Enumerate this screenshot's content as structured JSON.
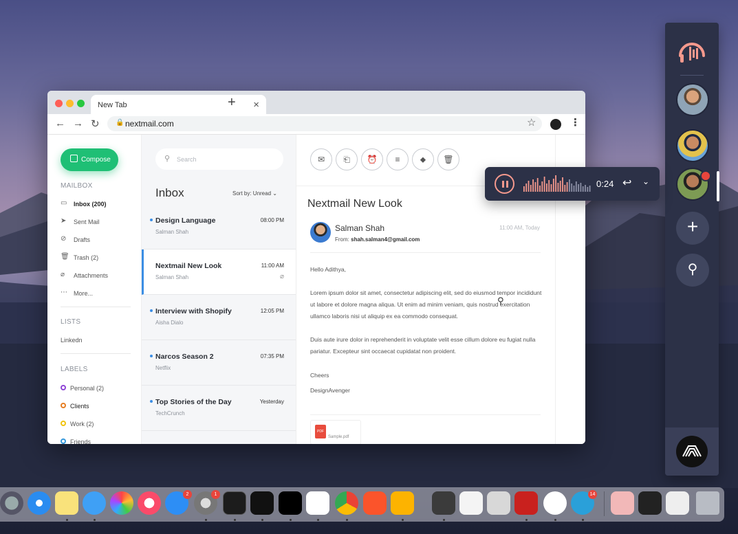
{
  "browser": {
    "tab_title": "New Tab",
    "url": "nextmail.com"
  },
  "sidebar": {
    "compose_label": "Compose",
    "mailbox_title": "MAILBOX",
    "mailbox_items": [
      {
        "label": "Inbox (200)",
        "icon": "inbox-icon"
      },
      {
        "label": "Sent Mail",
        "icon": "send-icon"
      },
      {
        "label": "Drafts",
        "icon": "draft-icon"
      },
      {
        "label": "Trash (2)",
        "icon": "trash-icon"
      },
      {
        "label": "Attachments",
        "icon": "paperclip-icon"
      },
      {
        "label": "More...",
        "icon": "more-icon"
      }
    ],
    "lists_title": "LISTS",
    "lists_items": [
      {
        "label": "Linkedn"
      }
    ],
    "labels_title": "LABELS",
    "labels_items": [
      {
        "label": "Personal (2)",
        "color": "#8e44d6"
      },
      {
        "label": "Clients",
        "color": "#e67e22"
      },
      {
        "label": "Work (2)",
        "color": "#f1c40f"
      },
      {
        "label": "Friends",
        "color": "#3498db"
      }
    ]
  },
  "list": {
    "search_placeholder": "Search",
    "title": "Inbox",
    "sort_label": "Sort by: Unread",
    "messages": [
      {
        "subject": "Design Language",
        "time": "08:00 PM",
        "from": "Salman Shah",
        "unread": true
      },
      {
        "subject": "Nextmail New Look",
        "time": "11:00 AM",
        "from": "Salman Shah",
        "unread": false,
        "attachment": true
      },
      {
        "subject": "Interview with Shopify",
        "time": "12:05 PM",
        "from": "Aisha Dialo",
        "unread": true
      },
      {
        "subject": "Narcos Season 2",
        "time": "07:35 PM",
        "from": "Netflix",
        "unread": true
      },
      {
        "subject": "Top Stories of the Day",
        "time": "Yesterday",
        "from": "TechCrunch",
        "unread": true
      }
    ]
  },
  "reader": {
    "toolbar_icons": [
      "mark-read-icon",
      "move-icon",
      "snooze-icon",
      "notes-icon",
      "tag-icon",
      "delete-icon"
    ],
    "title": "Nextmail New Look",
    "sender": "Salman Shah",
    "from_label": "From:",
    "from_email": "shah.salman4@gmail.com",
    "time": "11:00 AM, Today",
    "greeting": "Hello Adithya,",
    "para1": "Lorem ipsum dolor sit amet, consectetur adipiscing elit, sed do eiusmod tempor incididunt ut labore et dolore magna aliqua. Ut enim ad minim veniam, quis nostrud exercitation ullamco laboris nisi ut aliquip ex ea commodo consequat.",
    "para2": "Duis aute irure dolor in reprehenderit in voluptate velit esse cillum dolore eu fugiat nulla pariatur. Excepteur sint occaecat cupidatat non proident.",
    "sign1": "Cheers",
    "sign2": "DesignAvenger",
    "attachment_name": "Sample.pdf",
    "attachment_type": "PDF"
  },
  "player": {
    "time": "0:24"
  },
  "dock_badges": {
    "appstore": "2",
    "settings": "1",
    "telegram": "14"
  },
  "colors": {
    "accent": "#1fbf75",
    "unread_dot": "#3b8ee4",
    "panel_bg": "#2c3147",
    "record": "#e8453c"
  }
}
